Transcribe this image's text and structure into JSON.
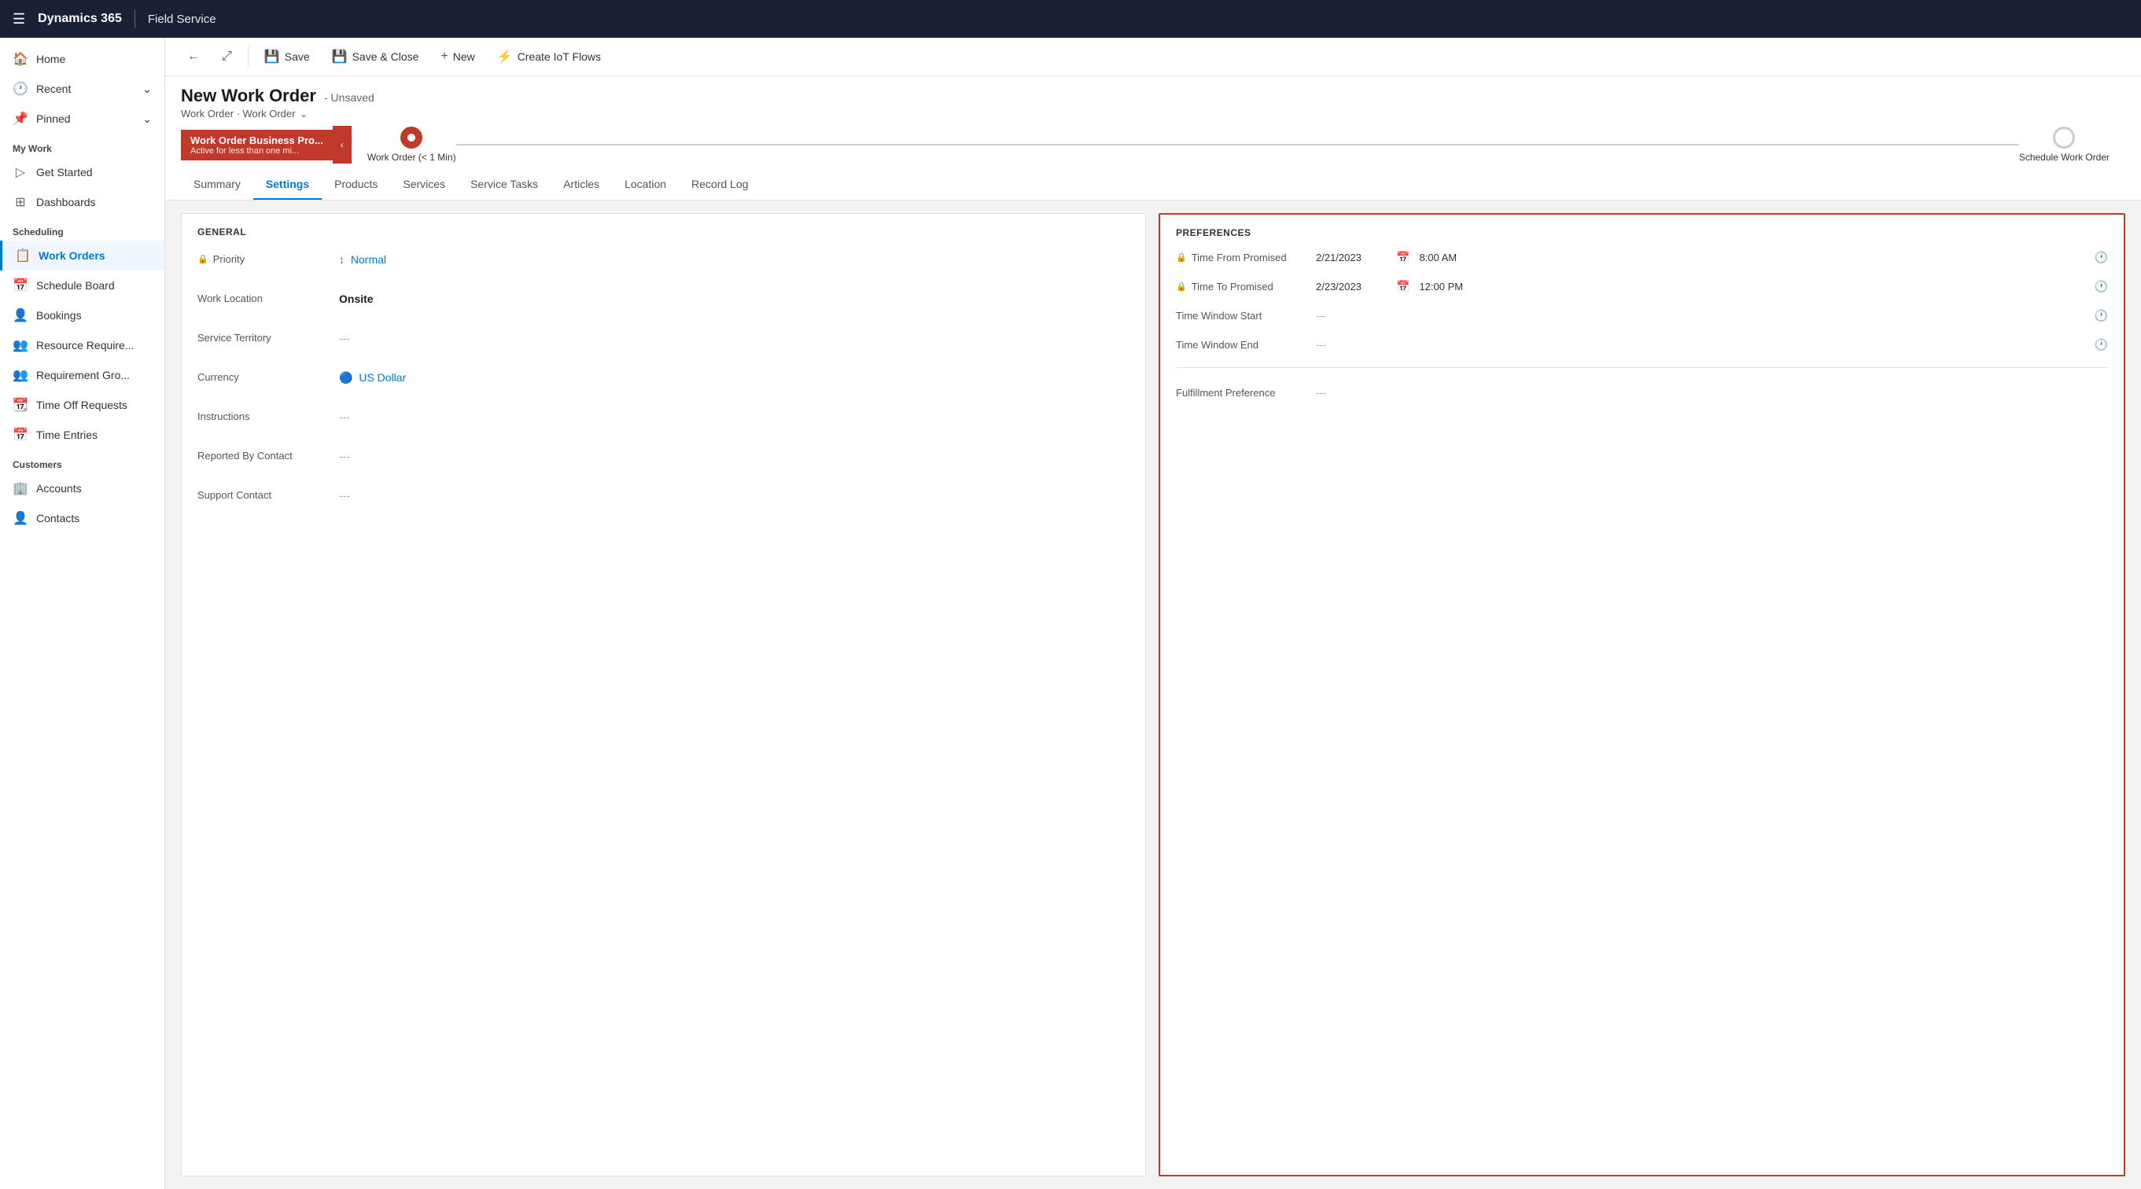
{
  "topNav": {
    "hamburger": "☰",
    "brand": "Dynamics 365",
    "divider": "|",
    "module": "Field Service"
  },
  "sidebar": {
    "sections": [
      {
        "items": [
          {
            "id": "home",
            "label": "Home",
            "icon": "🏠",
            "hasArrow": false,
            "active": false
          },
          {
            "id": "recent",
            "label": "Recent",
            "icon": "🕐",
            "hasArrow": true,
            "active": false
          },
          {
            "id": "pinned",
            "label": "Pinned",
            "icon": "📌",
            "hasArrow": true,
            "active": false
          }
        ]
      },
      {
        "title": "My Work",
        "items": [
          {
            "id": "get-started",
            "label": "Get Started",
            "icon": "▷",
            "hasArrow": false,
            "active": false
          },
          {
            "id": "dashboards",
            "label": "Dashboards",
            "icon": "⊞",
            "hasArrow": false,
            "active": false
          }
        ]
      },
      {
        "title": "Scheduling",
        "items": [
          {
            "id": "work-orders",
            "label": "Work Orders",
            "icon": "📋",
            "hasArrow": false,
            "active": true
          },
          {
            "id": "schedule-board",
            "label": "Schedule Board",
            "icon": "📅",
            "hasArrow": false,
            "active": false
          },
          {
            "id": "bookings",
            "label": "Bookings",
            "icon": "👤",
            "hasArrow": false,
            "active": false
          },
          {
            "id": "resource-req",
            "label": "Resource Require...",
            "icon": "👥",
            "hasArrow": false,
            "active": false
          },
          {
            "id": "requirement-gro",
            "label": "Requirement Gro...",
            "icon": "👥",
            "hasArrow": false,
            "active": false
          },
          {
            "id": "time-off",
            "label": "Time Off Requests",
            "icon": "📆",
            "hasArrow": false,
            "active": false
          },
          {
            "id": "time-entries",
            "label": "Time Entries",
            "icon": "📅",
            "hasArrow": false,
            "active": false
          }
        ]
      },
      {
        "title": "Customers",
        "items": [
          {
            "id": "accounts",
            "label": "Accounts",
            "icon": "🏢",
            "hasArrow": false,
            "active": false
          },
          {
            "id": "contacts",
            "label": "Contacts",
            "icon": "👤",
            "hasArrow": false,
            "active": false
          }
        ]
      }
    ]
  },
  "toolbar": {
    "back_icon": "←",
    "expand_icon": "⤢",
    "save_label": "Save",
    "save_icon": "💾",
    "save_close_label": "Save & Close",
    "save_close_icon": "💾",
    "new_label": "New",
    "new_icon": "+",
    "iot_label": "Create IoT Flows",
    "iot_icon": "⚡"
  },
  "pageHeader": {
    "title": "New Work Order",
    "status": "Unsaved",
    "breadcrumb1": "Work Order",
    "breadcrumb2": "Work Order"
  },
  "progressBar": {
    "stage1": {
      "title": "Work Order Business Pro...",
      "subtitle": "Active for less than one mi...",
      "color": "#c0392b"
    },
    "node1": {
      "label": "Work Order (< 1 Min)",
      "active": true
    },
    "node2": {
      "label": "Schedule Work Order",
      "active": false
    }
  },
  "tabs": [
    {
      "id": "summary",
      "label": "Summary",
      "active": false
    },
    {
      "id": "settings",
      "label": "Settings",
      "active": true
    },
    {
      "id": "products",
      "label": "Products",
      "active": false
    },
    {
      "id": "services",
      "label": "Services",
      "active": false
    },
    {
      "id": "service-tasks",
      "label": "Service Tasks",
      "active": false
    },
    {
      "id": "articles",
      "label": "Articles",
      "active": false
    },
    {
      "id": "location",
      "label": "Location",
      "active": false
    },
    {
      "id": "record-log",
      "label": "Record Log",
      "active": false
    }
  ],
  "general": {
    "title": "GENERAL",
    "fields": [
      {
        "id": "priority",
        "label": "Priority",
        "value": "Normal",
        "type": "link",
        "hasLockIcon": true
      },
      {
        "id": "work-location",
        "label": "Work Location",
        "value": "Onsite",
        "type": "bold",
        "hasLockIcon": false
      },
      {
        "id": "service-territory",
        "label": "Service Territory",
        "value": "---",
        "type": "muted",
        "hasLockIcon": false
      },
      {
        "id": "currency",
        "label": "Currency",
        "value": "US Dollar",
        "type": "link",
        "hasLockIcon": false,
        "hasIcon": true
      },
      {
        "id": "instructions",
        "label": "Instructions",
        "value": "---",
        "type": "muted",
        "hasLockIcon": false
      },
      {
        "id": "reported-by",
        "label": "Reported By Contact",
        "value": "---",
        "type": "muted",
        "hasLockIcon": false
      },
      {
        "id": "support-contact",
        "label": "Support Contact",
        "value": "---",
        "type": "muted",
        "hasLockIcon": false
      }
    ]
  },
  "preferences": {
    "title": "PREFERENCES",
    "timeFromPromised": {
      "label": "Time From Promised",
      "date": "2/21/2023",
      "time": "8:00 AM"
    },
    "timeToPromised": {
      "label": "Time To Promised",
      "date": "2/23/2023",
      "time": "12:00 PM"
    },
    "timeWindowStart": {
      "label": "Time Window Start",
      "value": "---"
    },
    "timeWindowEnd": {
      "label": "Time Window End",
      "value": "---"
    },
    "fulfillmentPreference": {
      "label": "Fulfillment Preference",
      "value": "---"
    }
  }
}
